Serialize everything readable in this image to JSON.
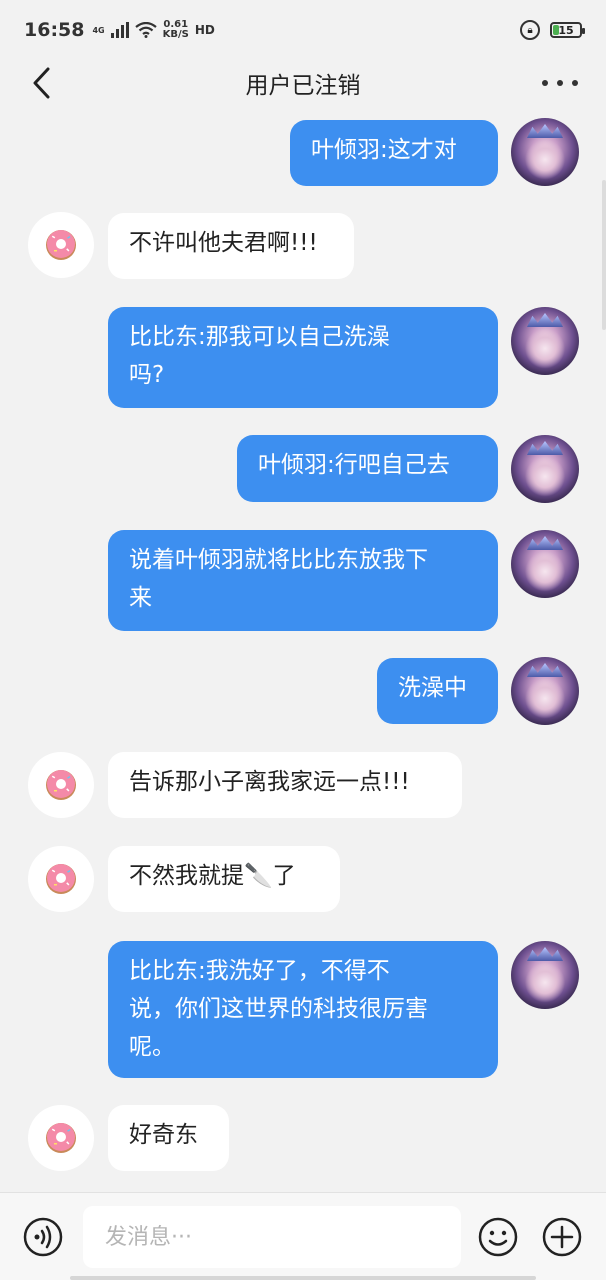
{
  "status_bar": {
    "time": "16:58",
    "network": "4G",
    "net_speed": "0.61",
    "net_unit": "KB/S",
    "hd": "HD",
    "battery": "15"
  },
  "header": {
    "title": "用户已注销"
  },
  "messages": [
    {
      "side": "right",
      "text": "叶倾羽:这才对"
    },
    {
      "side": "left",
      "text": "不许叫他夫君啊!!!"
    },
    {
      "side": "right",
      "text": "比比东:那我可以自己洗澡\n吗?"
    },
    {
      "side": "right",
      "text": "叶倾羽:行吧自己去"
    },
    {
      "side": "right",
      "text": "说着叶倾羽就将比比东放我下\n来"
    },
    {
      "side": "right",
      "text": "洗澡中"
    },
    {
      "side": "left",
      "text": "告诉那小子离我家远一点!!!"
    },
    {
      "side": "left",
      "text": "不然我就提🔪了"
    },
    {
      "side": "right",
      "text": "比比东:我洗好了，不得不\n说，你们这世界的科技很厉害\n呢。"
    },
    {
      "side": "left",
      "text": "好奇东"
    }
  ],
  "input": {
    "placeholder": "发消息···"
  },
  "icons": {
    "back": "chevron-left-icon",
    "more": "more-dots-icon",
    "voice": "voice-icon",
    "emoji": "emoji-icon",
    "add": "plus-circle-icon",
    "left_avatar": "donut-icon"
  },
  "colors": {
    "right_bubble": "#3d8ff0",
    "left_bubble": "#ffffff",
    "background": "#f2f2f2"
  }
}
